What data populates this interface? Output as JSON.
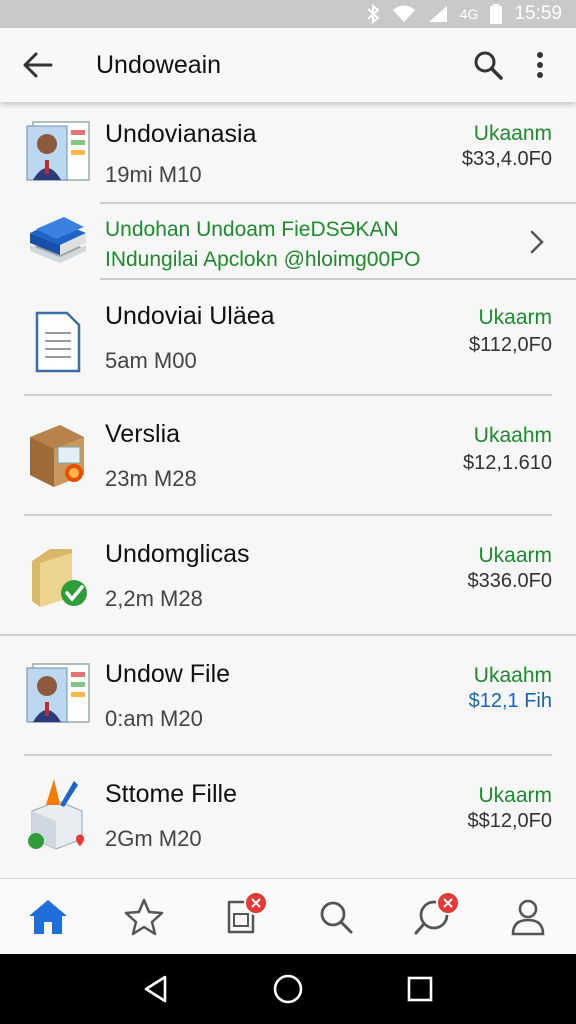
{
  "status_bar": {
    "signal_text": "4G",
    "time": "15:59"
  },
  "app_bar": {
    "title": "Undoweain"
  },
  "banner": {
    "line1": "Undohan Undoam FieDSƏKAN",
    "line2": "INdungilai Apclokn @hloimg00PO"
  },
  "files": [
    {
      "name": "Undovianasia",
      "meta": "19mi M10",
      "status": "Ukaanm",
      "price": "$33,4.0F0",
      "icon": "contact-card-icon"
    },
    {
      "name": "Undoviai Uläea",
      "meta": "5am M00",
      "status": "Ukaarm",
      "price": "$112,0F0",
      "icon": "document-icon"
    },
    {
      "name": "Verslia",
      "meta": "23m M28",
      "status": "Ukaahm",
      "price": "$12,1.610",
      "icon": "package-icon"
    },
    {
      "name": "Undomglicas",
      "meta": "2,2m M28",
      "status": "Ukaarm",
      "price": "$336.0F0",
      "icon": "folder-check-icon"
    },
    {
      "name": "Undow File",
      "meta": "0:am M20",
      "status": "Ukaahm",
      "price": "$12,1 Fih",
      "icon": "contact-card-icon"
    },
    {
      "name": "Sttome Fille",
      "meta": "2Gm M20",
      "status": "Ukaarm",
      "price": "$$12,0F0",
      "icon": "box-tools-icon"
    }
  ],
  "bottom_nav": [
    "home-icon",
    "star-icon",
    "sim-card-icon",
    "search-icon",
    "chat-icon",
    "profile-icon"
  ],
  "colors": {
    "accent_green": "#1f8a2e",
    "accent_blue": "#1565c0",
    "badge_red": "#e53935",
    "nav_active": "#1e6fd9"
  }
}
